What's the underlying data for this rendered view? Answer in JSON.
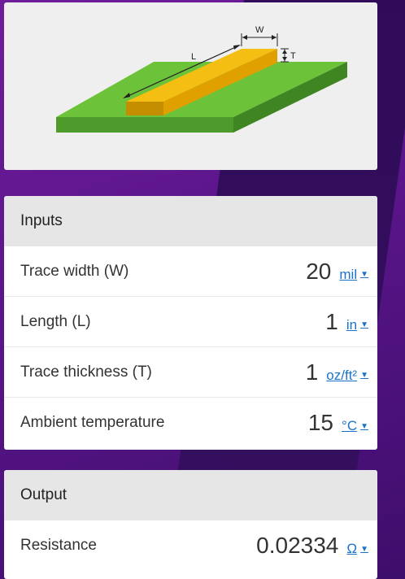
{
  "diagram": {
    "labels": {
      "width": "W",
      "length": "L",
      "thickness": "T"
    },
    "colors": {
      "board_top": "#6cc33a",
      "board_side": "#4e9a2a",
      "trace_top": "#f5be12",
      "trace_side": "#c28a00"
    }
  },
  "inputs": {
    "header": "Inputs",
    "rows": [
      {
        "label": "Trace width (W)",
        "value": "20",
        "unit": "mil"
      },
      {
        "label": "Length (L)",
        "value": "1",
        "unit": "in"
      },
      {
        "label": "Trace thickness (T)",
        "value": "1",
        "unit": "oz/ft²"
      },
      {
        "label": "Ambient temperature",
        "value": "15",
        "unit": "°C"
      }
    ]
  },
  "output": {
    "header": "Output",
    "rows": [
      {
        "label": "Resistance",
        "value": "0.02334",
        "unit": "Ω"
      }
    ]
  },
  "icons": {
    "unit_dropdown": "caret-down-icon"
  }
}
